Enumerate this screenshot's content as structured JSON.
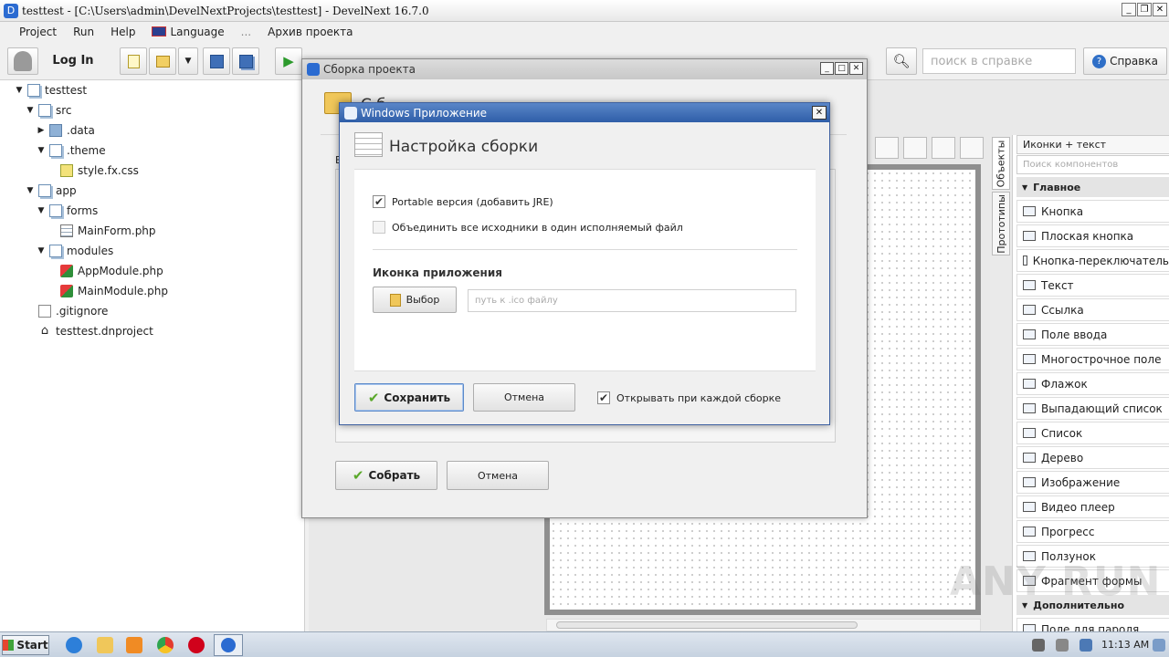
{
  "window": {
    "title": "testtest - [C:\\Users\\admin\\DevelNextProjects\\testtest] - DevelNext 16.7.0"
  },
  "menu": {
    "items": [
      "Project",
      "Run",
      "Help",
      "Language",
      "...",
      "Архив проекта"
    ]
  },
  "toolbar": {
    "login_label": "Log In",
    "search_placeholder": "поиск в справке",
    "help_label": "Справка"
  },
  "tree": [
    {
      "label": "testtest",
      "depth": 0,
      "expander": "▼",
      "icon": "project-folder-icon"
    },
    {
      "label": "src",
      "depth": 1,
      "expander": "▼",
      "icon": "folder-icon"
    },
    {
      "label": ".data",
      "depth": 2,
      "expander": "▶",
      "icon": "data-folder-icon"
    },
    {
      "label": ".theme",
      "depth": 2,
      "expander": "▼",
      "icon": "folder-icon"
    },
    {
      "label": "style.fx.css",
      "depth": 3,
      "expander": "",
      "icon": "css-file-icon"
    },
    {
      "label": "app",
      "depth": 1,
      "expander": "▼",
      "icon": "folder-icon"
    },
    {
      "label": "forms",
      "depth": 2,
      "expander": "▼",
      "icon": "folder-icon"
    },
    {
      "label": "MainForm.php",
      "depth": 3,
      "expander": "",
      "icon": "form-file-icon"
    },
    {
      "label": "modules",
      "depth": 2,
      "expander": "▼",
      "icon": "folder-icon"
    },
    {
      "label": "AppModule.php",
      "depth": 3,
      "expander": "",
      "icon": "module-file-icon"
    },
    {
      "label": "MainModule.php",
      "depth": 3,
      "expander": "",
      "icon": "module-file-icon"
    },
    {
      "label": ".gitignore",
      "depth": 1,
      "expander": "",
      "icon": "file-icon"
    },
    {
      "label": "testtest.dnproject",
      "depth": 1,
      "expander": "",
      "icon": "home-icon"
    }
  ],
  "components": {
    "view_mode": "Иконки + текст",
    "search_placeholder": "Поиск компонентов",
    "tabs": [
      "Объекты",
      "Прототипы"
    ],
    "section_main": "Главное",
    "section_extra": "Дополнительно",
    "items": [
      "Кнопка",
      "Плоская кнопка",
      "Кнопка-переключатель",
      "Текст",
      "Ссылка",
      "Поле ввода",
      "Многострочное поле",
      "Флажок",
      "Выпадающий список",
      "Список",
      "Дерево",
      "Изображение",
      "Видео плеер",
      "Прогресс",
      "Ползунок",
      "Фрагмент формы"
    ],
    "partial_item": "Поле для пароля"
  },
  "build_dialog": {
    "title": "Сборка проекта",
    "header_partial": "С б",
    "side_label": "В",
    "build_label": "Собрать",
    "cancel_label": "Отмена"
  },
  "windows_dialog": {
    "title": "Windows Приложение",
    "heading": "Настройка сборки",
    "portable_label": "Portable версия (добавить JRE)",
    "portable_checked": true,
    "merge_label": "Объединить все исходники в один исполняемый файл",
    "merge_checked": false,
    "icon_section": "Иконка приложения",
    "choose_label": "Выбор",
    "icon_path_placeholder": "путь к .ico файлу",
    "save_label": "Сохранить",
    "cancel_label": "Отмена",
    "open_each_label": "Открывать при каждой сборке",
    "open_each_checked": true
  },
  "taskbar": {
    "start_label": "Start",
    "clock": "11:13 AM"
  },
  "watermark": "ANY RUN"
}
